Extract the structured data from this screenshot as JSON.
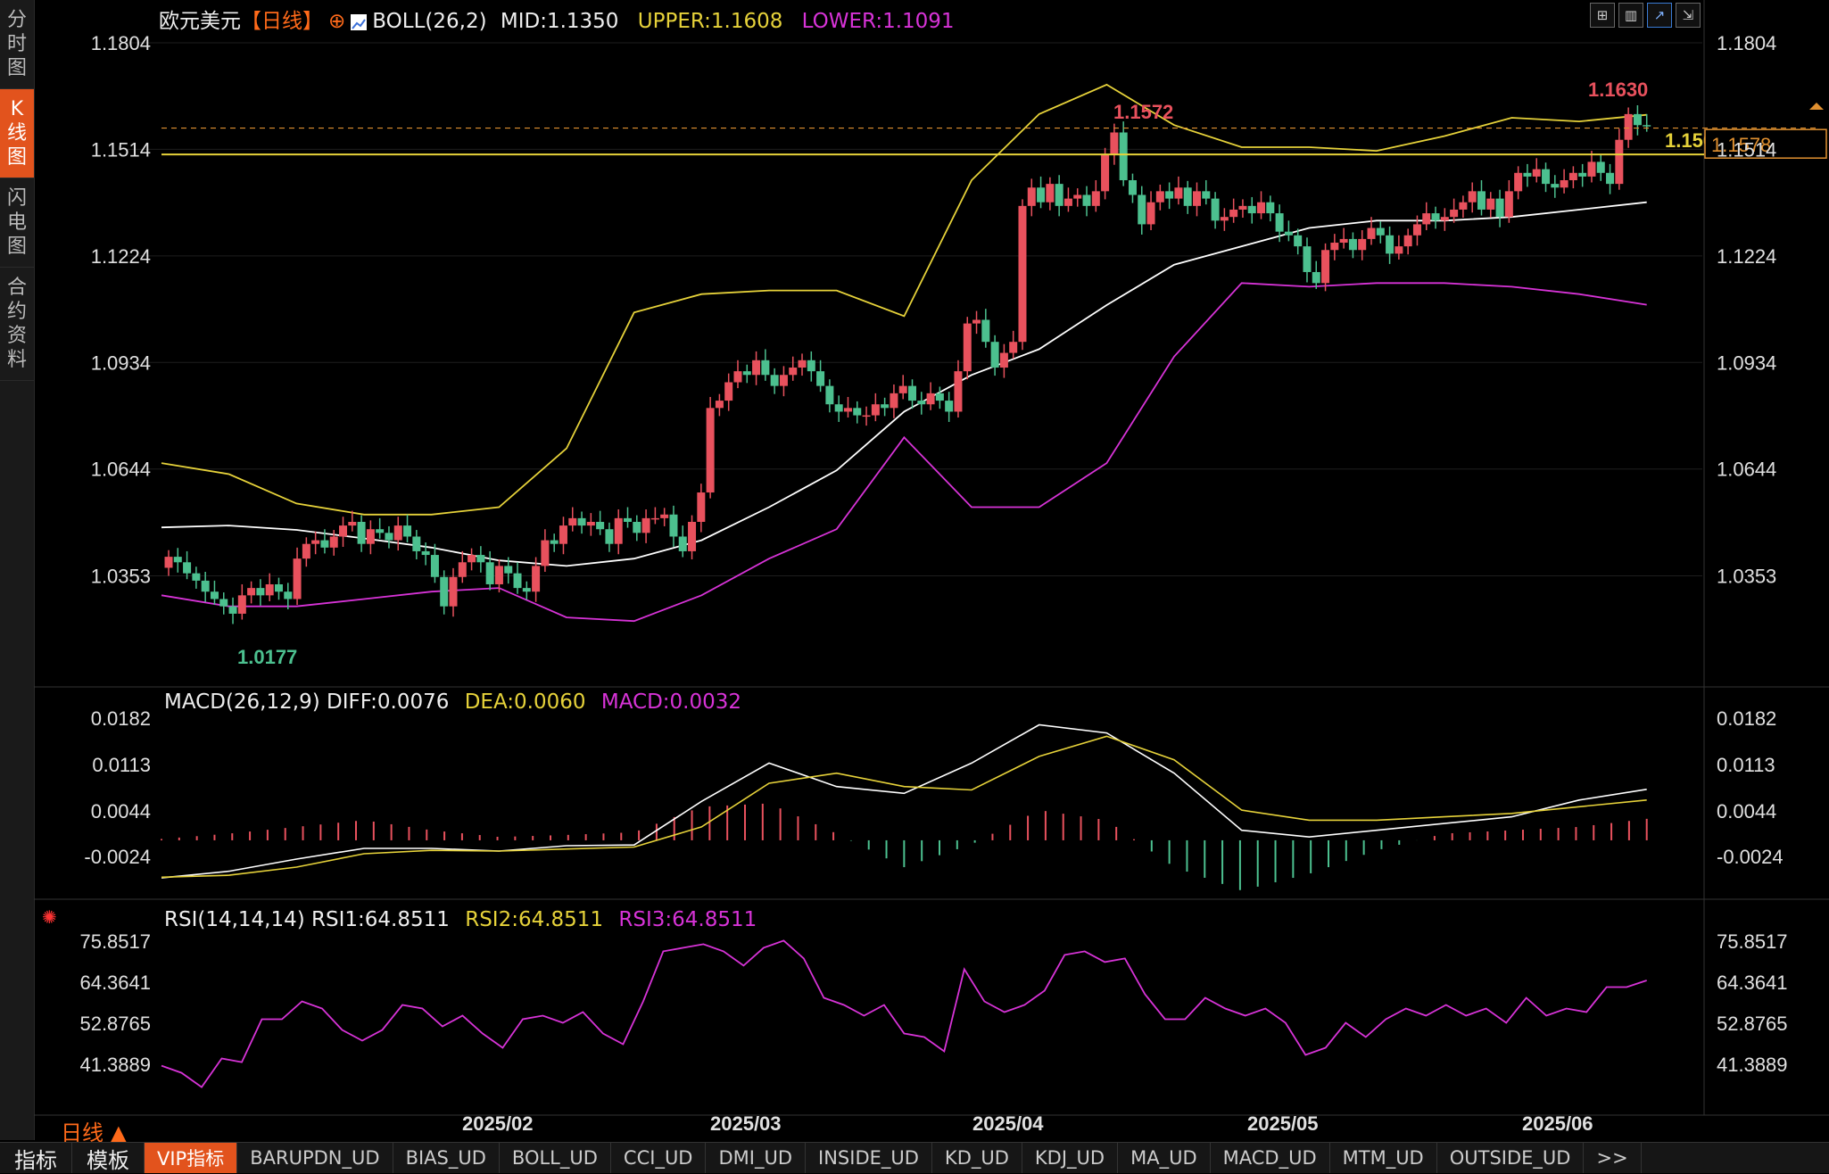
{
  "sidebar": {
    "tabs": [
      {
        "label": "分时图",
        "active": false
      },
      {
        "label": "K线图",
        "active": true
      },
      {
        "label": "闪电图",
        "active": false
      },
      {
        "label": "合约资料",
        "active": false
      }
    ]
  },
  "header": {
    "symbol": "欧元美元",
    "period_tag": "【日线】",
    "add_icon": "⊕",
    "indicator": "BOLL(26,2)",
    "mid": "MID:1.1350",
    "upper": "UPPER:1.1608",
    "lower": "LOWER:1.1091"
  },
  "toolbar_icons": [
    "grid-icon",
    "bar-chart-icon",
    "line-chart-icon",
    "collapse-icon"
  ],
  "macd_header": {
    "name": "MACD(26,12,9)",
    "diff": "DIFF:0.0076",
    "dea": "DEA:0.0060",
    "macd": "MACD:0.0032"
  },
  "rsi_header": {
    "name": "RSI(14,14,14)",
    "rsi1": "RSI1:64.8511",
    "rsi2": "RSI2:64.8511",
    "rsi3": "RSI3:64.8511"
  },
  "axis": {
    "price_ticks": [
      "1.1804",
      "1.1514",
      "1.1224",
      "1.0934",
      "1.0644",
      "1.0353"
    ],
    "macd_ticks": [
      "0.0182",
      "0.0113",
      "0.0044",
      "-0.0024"
    ],
    "rsi_ticks": [
      "75.8517",
      "64.3641",
      "52.8765",
      "41.3889"
    ],
    "dates": [
      "2025/02",
      "2025/03",
      "2025/04",
      "2025/05",
      "2025/06"
    ]
  },
  "annotations": {
    "high_label": "1.1572",
    "recent_high": "1.1630",
    "low_label": "1.0177",
    "hline_label": "1.1500",
    "last_price": "1.1578"
  },
  "colors": {
    "up": "#e8515d",
    "down": "#4cc08f",
    "mid": "#ffffff",
    "upper": "#e6d23a",
    "lower": "#d733d7",
    "hline": "#e6d23a",
    "dash": "#e09030"
  },
  "period_label": "日线 ▲",
  "bottom_tabs": [
    "指标",
    "模板",
    "VIP指标",
    "BARUPDN_UD",
    "BIAS_UD",
    "BOLL_UD",
    "CCI_UD",
    "DMI_UD",
    "INSIDE_UD",
    "KD_UD",
    "KDJ_UD",
    "MA_UD",
    "MACD_UD",
    "MTM_UD",
    "OUTSIDE_UD",
    ">>"
  ],
  "chart_data": [
    {
      "type": "candlestick",
      "title": "欧元美元 日线 BOLL(26,2)",
      "x": [
        "2025/02",
        "2025/03",
        "2025/04",
        "2025/05",
        "2025/06"
      ],
      "ylim": [
        1.0177,
        1.1804
      ],
      "close": [
        1.0405,
        1.039,
        1.036,
        1.034,
        1.031,
        1.029,
        1.027,
        1.025,
        1.03,
        1.032,
        1.03,
        1.033,
        1.031,
        1.029,
        1.04,
        1.044,
        1.045,
        1.043,
        1.046,
        1.049,
        1.05,
        1.044,
        1.048,
        1.047,
        1.045,
        1.049,
        1.046,
        1.042,
        1.041,
        1.035,
        1.027,
        1.035,
        1.039,
        1.041,
        1.039,
        1.033,
        1.038,
        1.036,
        1.032,
        1.031,
        1.038,
        1.045,
        1.044,
        1.049,
        1.051,
        1.049,
        1.05,
        1.048,
        1.044,
        1.051,
        1.05,
        1.047,
        1.051,
        1.051,
        1.052,
        1.046,
        1.042,
        1.05,
        1.058,
        1.081,
        1.083,
        1.088,
        1.091,
        1.09,
        1.094,
        1.09,
        1.087,
        1.09,
        1.092,
        1.094,
        1.091,
        1.087,
        1.082,
        1.08,
        1.081,
        1.079,
        1.079,
        1.082,
        1.081,
        1.085,
        1.087,
        1.083,
        1.082,
        1.085,
        1.083,
        1.08,
        1.091,
        1.104,
        1.105,
        1.099,
        1.092,
        1.096,
        1.099,
        1.136,
        1.141,
        1.137,
        1.142,
        1.136,
        1.138,
        1.139,
        1.136,
        1.14,
        1.15,
        1.156,
        1.143,
        1.139,
        1.131,
        1.137,
        1.14,
        1.138,
        1.141,
        1.136,
        1.14,
        1.138,
        1.132,
        1.133,
        1.135,
        1.136,
        1.134,
        1.137,
        1.134,
        1.129,
        1.128,
        1.125,
        1.118,
        1.115,
        1.124,
        1.126,
        1.127,
        1.124,
        1.127,
        1.13,
        1.128,
        1.123,
        1.125,
        1.128,
        1.131,
        1.134,
        1.132,
        1.133,
        1.135,
        1.137,
        1.14,
        1.135,
        1.138,
        1.133,
        1.14,
        1.145,
        1.144,
        1.146,
        1.142,
        1.141,
        1.143,
        1.145,
        1.144,
        1.148,
        1.145,
        1.142,
        1.154,
        1.161,
        1.158,
        1.1578
      ],
      "boll_mid": [
        1.0485,
        1.049,
        1.0478,
        1.0455,
        1.043,
        1.0395,
        1.038,
        1.04,
        1.045,
        1.054,
        1.064,
        1.08,
        1.09,
        1.097,
        1.109,
        1.12,
        1.125,
        1.13,
        1.132,
        1.132,
        1.133,
        1.135,
        1.137
      ],
      "boll_upper": [
        1.066,
        1.063,
        1.055,
        1.052,
        1.052,
        1.054,
        1.07,
        1.107,
        1.112,
        1.113,
        1.113,
        1.106,
        1.143,
        1.161,
        1.169,
        1.158,
        1.152,
        1.152,
        1.151,
        1.155,
        1.16,
        1.159,
        1.1608
      ],
      "boll_lower": [
        1.03,
        1.027,
        1.027,
        1.029,
        1.031,
        1.032,
        1.024,
        1.023,
        1.03,
        1.04,
        1.048,
        1.073,
        1.054,
        1.054,
        1.066,
        1.095,
        1.115,
        1.114,
        1.115,
        1.115,
        1.114,
        1.112,
        1.1091
      ],
      "horizontal_line": 1.15,
      "last_price": 1.1578
    },
    {
      "type": "bar",
      "title": "MACD(26,12,9)",
      "ylim": [
        -0.0024,
        0.0182
      ],
      "diff": [
        -0.0056,
        -0.0046,
        -0.0028,
        -0.0012,
        -0.0012,
        -0.0016,
        -0.0008,
        -0.0007,
        0.0058,
        0.0115,
        0.008,
        0.007,
        0.0115,
        0.0172,
        0.016,
        0.01,
        0.0015,
        0.0005,
        0.0015,
        0.0025,
        0.0035,
        0.006,
        0.0076
      ],
      "dea": [
        -0.0055,
        -0.0052,
        -0.004,
        -0.002,
        -0.0015,
        -0.0016,
        -0.0013,
        -0.001,
        0.002,
        0.0085,
        0.01,
        0.008,
        0.0075,
        0.0125,
        0.0155,
        0.012,
        0.0045,
        0.003,
        0.003,
        0.0035,
        0.004,
        0.005,
        0.006
      ],
      "macd": [
        0.0002,
        0.001,
        0.002,
        0.003,
        0.0015,
        0.0005,
        0.0008,
        0.0012,
        0.005,
        0.0055,
        0.001,
        -0.004,
        -0.0006,
        0.0045,
        0.003,
        -0.004,
        -0.0075,
        -0.005,
        -0.0015,
        0.001,
        0.0015,
        0.002,
        0.0032
      ]
    },
    {
      "type": "line",
      "title": "RSI(14,14,14)",
      "ylim": [
        41.3889,
        75.8517
      ],
      "rsi": [
        41,
        39,
        35,
        43,
        42,
        54,
        54,
        59,
        57,
        51,
        48,
        51,
        58,
        57,
        52,
        55,
        50,
        46,
        54,
        55,
        53,
        56,
        50,
        47,
        59,
        73,
        74,
        75,
        73,
        69,
        74,
        76,
        71,
        60,
        58,
        55,
        58,
        50,
        49,
        45,
        68,
        59,
        56,
        58,
        62,
        72,
        73,
        70,
        71,
        61,
        54,
        54,
        60,
        57,
        55,
        57,
        53,
        44,
        46,
        53,
        49,
        54,
        57,
        55,
        58,
        55,
        57,
        53,
        60,
        55,
        57,
        56,
        63,
        63,
        64.8511
      ]
    }
  ]
}
